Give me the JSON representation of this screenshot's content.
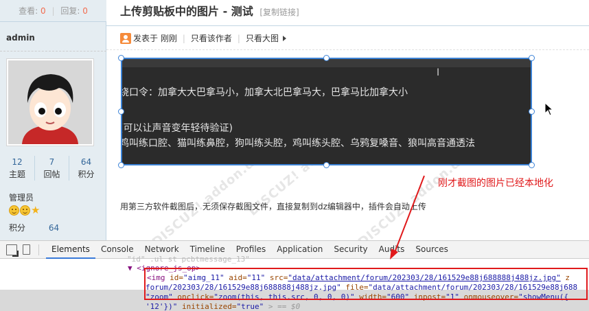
{
  "sidebar": {
    "stats": {
      "views_label": "查看:",
      "views_value": "0",
      "replies_label": "回复:",
      "replies_value": "0"
    },
    "author": "admin",
    "user_stats": [
      {
        "value": "12",
        "label": "主题"
      },
      {
        "value": "7",
        "label": "回帖"
      },
      {
        "value": "64",
        "label": "积分"
      }
    ],
    "group": "管理员",
    "points_label": "积分",
    "points_value": "64"
  },
  "thread": {
    "title": "上传剪贴板中的图片 - 测试",
    "copy_link": "[复制链接]",
    "meta": {
      "posted": "发表于 刚刚",
      "only_author": "只看该作者",
      "big_image": "只看大图"
    },
    "image_lines": [
      "绕口令：加拿大大巴拿马小，加拿大北巴拿马大，巴拿马比加拿大小",
      "(可以让声音变年轻待验证)",
      "鸡叫练口腔、猫叫练鼻腔，狗叫练头腔，鸡叫练头腔、乌鸦复嗓音、狼叫高音通透法"
    ],
    "annotation": "刚才截图的图片已经本地化",
    "body": "用第三方软件截图后，无须保存截图文件，直接复制到dz编辑器中，插件会自动上传",
    "watermarks": [
      "DISCUZ! addon.discuz.com",
      "DISCUZ! addon.discuz.com",
      "DISCUZ! addon.discuz.com"
    ]
  },
  "devtools": {
    "tabs": [
      "Elements",
      "Console",
      "Network",
      "Timeline",
      "Profiles",
      "Application",
      "Security",
      "Audits",
      "Sources"
    ],
    "active_tab": "Elements",
    "code": {
      "line1": "\"id\"  .ul  st  pcbtmessage_13\"",
      "line2_tag": "▼ <ignore_js_op>",
      "line3": {
        "open": "<img",
        "id_attr": "id=",
        "id_val": "\"aimg_11\"",
        "aid_attr": "aid=",
        "aid_val": "\"11\"",
        "src_attr": "src=",
        "src_val": "\"data/attachment/forum/202303/28/161529e88j688888j488jz.jpg\"",
        "tail": " z"
      },
      "line4": {
        "start": "forum/202303/28/161529e88j688888j488jz.jpg\"",
        "file_attr": "file=",
        "file_val": "\"data/attachment/forum/202303/28/161529e88j688"
      },
      "line5": {
        "zoom_val": "\"zoom\"",
        "onclick_attr": "onclick=",
        "onclick_val": "\"zoom(this, this.src, 0, 0, 0)\"",
        "width_attr": "width=",
        "width_val": "\"600\"",
        "inpost_attr": "inpost=",
        "inpost_val": "\"1\"",
        "onmouse_attr": "onmouseover=",
        "onmouse_val": "\"showMenu({"
      },
      "line6": {
        "start": "'12'})\"",
        "init_attr": "initialized=",
        "init_val": "\"true\"",
        "end": "> == $0"
      }
    }
  },
  "colors": {
    "accent": "#336699",
    "highlight": "#f26c4f",
    "annotation_red": "#e0191b",
    "selection_blue": "#3b82d6"
  }
}
